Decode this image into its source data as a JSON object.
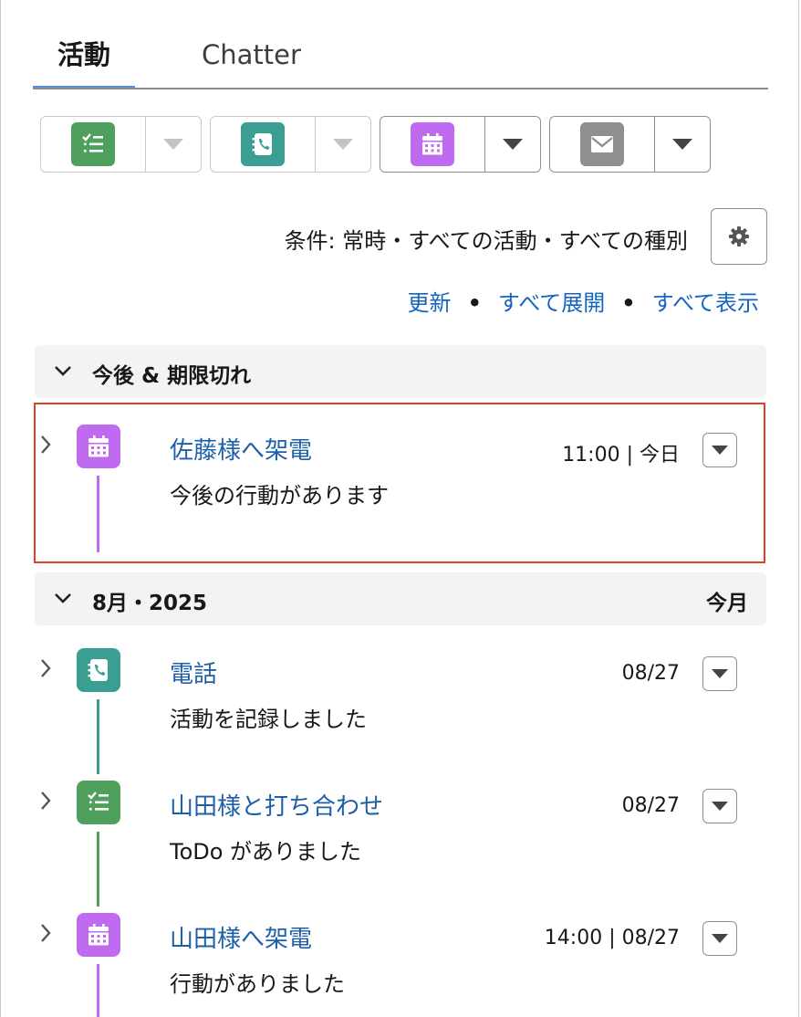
{
  "tabs": {
    "activity": "活動",
    "chatter": "Chatter"
  },
  "actions": [
    {
      "name": "new-task",
      "icon": "task-icon",
      "color": "#4ea05c",
      "disabled": true
    },
    {
      "name": "log-call",
      "icon": "call-icon",
      "color": "#3a9e92",
      "disabled": true
    },
    {
      "name": "new-event",
      "icon": "calendar-icon",
      "color": "#c06af0",
      "disabled": false
    },
    {
      "name": "email",
      "icon": "email-icon",
      "color": "#8f8f8f",
      "disabled": false
    }
  ],
  "filter": {
    "text": "条件: 常時・すべての活動・すべての種別"
  },
  "links": {
    "refresh": "更新",
    "expand_all": "すべて展開",
    "view_all": "すべて表示",
    "separator": "•"
  },
  "sections": {
    "upcoming": {
      "title": "今後 & 期限切れ"
    },
    "month": {
      "title": "8月・2025",
      "right": "今月"
    }
  },
  "items": [
    {
      "subject": "佐藤様へ架電",
      "desc": "今後の行動があります",
      "date": "11:00 | 今日",
      "type": "event",
      "color": "#c06af0"
    },
    {
      "subject": "電話",
      "desc": "活動を記録しました",
      "date": "08/27",
      "type": "call",
      "color": "#3a9e92"
    },
    {
      "subject": "山田様と打ち合わせ",
      "desc": "ToDo がありました",
      "date": "08/27",
      "type": "task",
      "color": "#4ea05c"
    },
    {
      "subject": "山田様へ架電",
      "desc": "行動がありました",
      "date": "14:00 | 08/27",
      "type": "event",
      "color": "#c06af0"
    }
  ]
}
